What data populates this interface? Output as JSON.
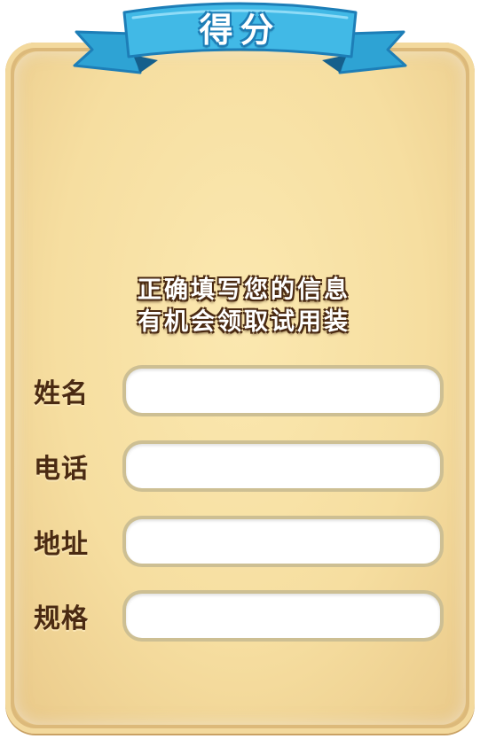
{
  "banner": {
    "title": "得分"
  },
  "instructions": {
    "line1": "正确填写您的信息",
    "line2": "有机会领取试用装"
  },
  "form": {
    "fields": [
      {
        "label": "姓名",
        "value": "",
        "placeholder": ""
      },
      {
        "label": "电话",
        "value": "",
        "placeholder": ""
      },
      {
        "label": "地址",
        "value": "",
        "placeholder": ""
      },
      {
        "label": "规格",
        "value": "",
        "placeholder": ""
      }
    ]
  },
  "colors": {
    "parchment": "#f6dea0",
    "parchment_edge": "#dcb97a",
    "ribbon": "#3fb6e3",
    "ribbon_dark": "#1d7eb7",
    "text_brown": "#4a2a12",
    "input_border": "#cdbf93",
    "input_fill": "#ffffff"
  }
}
